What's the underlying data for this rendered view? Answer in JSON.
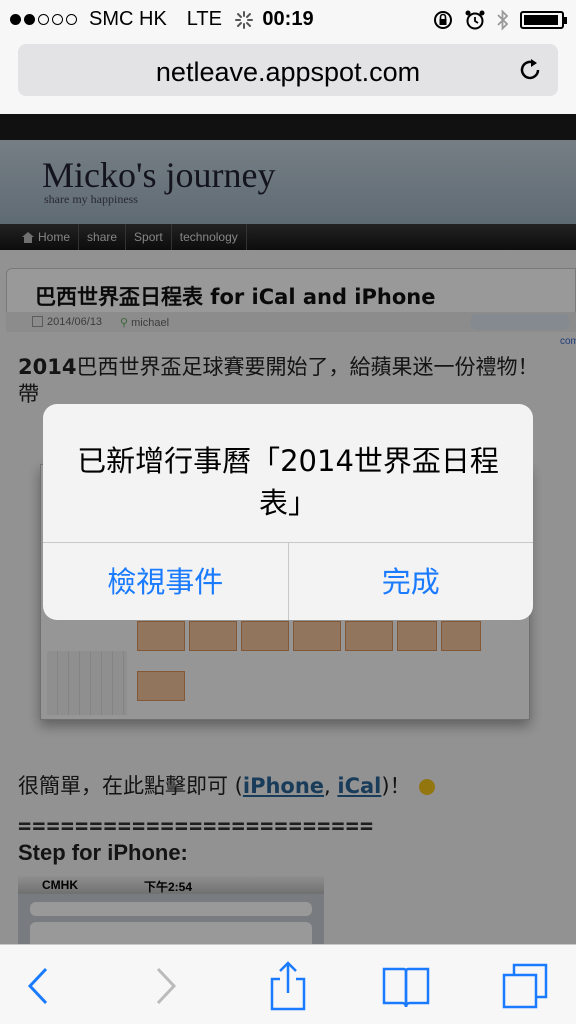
{
  "status_bar": {
    "carrier": "SMC HK",
    "network": "LTE",
    "time": "00:19",
    "signal_bars_filled": 2,
    "signal_bars_total": 5,
    "battery_level": 0.95
  },
  "browser": {
    "url": "netleave.appspot.com"
  },
  "site": {
    "title": "Micko's journey",
    "tagline": "share my happiness",
    "nav": [
      "Home",
      "share",
      "Sport",
      "technology"
    ]
  },
  "post": {
    "title": "巴西世界盃日程表 for iCal and iPhone",
    "date": "2014/06/13",
    "author": "michael",
    "comments": "No comments",
    "intro_bold": "2014",
    "intro_rest": "巴西世界盃足球賽要開始了，給蘋果迷一份禮物！",
    "intro_line2": "帶",
    "simple_prefix": "很簡單，在此點擊即可 (",
    "link_iphone": "iPhone",
    "sep": ", ",
    "link_ical": "iCal",
    "simple_suffix": ")！",
    "divider": "=========================",
    "step_heading": "Step for iPhone:",
    "screenshot_carrier": "CMHK",
    "screenshot_time": "下午2:54"
  },
  "alert": {
    "message": "已新增行事曆「2014世界盃日程表」",
    "button_view": "檢視事件",
    "button_done": "完成"
  },
  "colors": {
    "accent": "#1a7bff",
    "link": "#2a6496",
    "nav_bg": "#1d1d1d"
  }
}
